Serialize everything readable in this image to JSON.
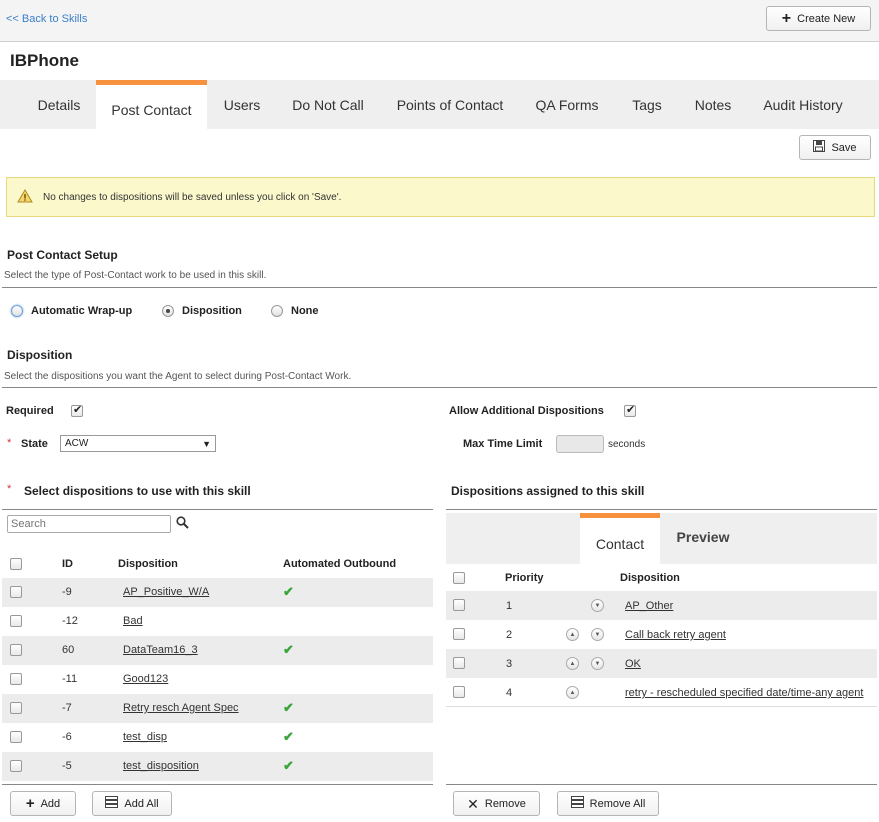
{
  "header": {
    "back_link": "<< Back to Skills",
    "create_new": "Create New"
  },
  "page_title": "IBPhone",
  "tabs": [
    "Details",
    "Post Contact",
    "Users",
    "Do Not Call",
    "Points of Contact",
    "QA Forms",
    "Tags",
    "Notes",
    "Audit History"
  ],
  "active_tab": "Post Contact",
  "toolbar": {
    "save": "Save"
  },
  "alert": {
    "text": "No changes to dispositions will be saved unless you click on 'Save'."
  },
  "setup": {
    "title": "Post Contact Setup",
    "desc": "Select the type of Post-Contact work to be used in this skill.",
    "options": [
      "Automatic Wrap-up",
      "Disposition",
      "None"
    ],
    "selected": "Disposition"
  },
  "disposition": {
    "title": "Disposition",
    "desc": "Select the dispositions you want the Agent to select during Post-Contact Work.",
    "required_label": "Required",
    "required_checked": true,
    "allow_label": "Allow Additional Dispositions",
    "allow_checked": true,
    "state_label": "State",
    "state_value": "ACW",
    "max_time_label": "Max Time Limit",
    "max_time_value": "",
    "seconds_label": "seconds"
  },
  "left_panel": {
    "title": "Select dispositions to use with this skill",
    "search_placeholder": "Search",
    "headers": {
      "id": "ID",
      "disposition": "Disposition",
      "automated": "Automated Outbound"
    },
    "rows": [
      {
        "id": "-9",
        "name": "AP_Positive_W/A",
        "auto": true
      },
      {
        "id": "-12",
        "name": "Bad",
        "auto": false
      },
      {
        "id": "60",
        "name": "DataTeam16_3",
        "auto": true
      },
      {
        "id": "-11",
        "name": "Good123",
        "auto": false
      },
      {
        "id": "-7",
        "name": "Retry resch Agent Spec",
        "auto": true
      },
      {
        "id": "-6",
        "name": "test_disp",
        "auto": true
      },
      {
        "id": "-5",
        "name": "test_disposition",
        "auto": true
      }
    ],
    "add": "Add",
    "add_all": "Add All"
  },
  "right_panel": {
    "title": "Dispositions assigned to this skill",
    "tabs": [
      "Contact",
      "Preview"
    ],
    "active_tab": "Contact",
    "headers": {
      "priority": "Priority",
      "disposition": "Disposition"
    },
    "rows": [
      {
        "priority": "1",
        "name": "AP_Other",
        "up": false,
        "down": true
      },
      {
        "priority": "2",
        "name": "Call back retry agent",
        "up": true,
        "down": true
      },
      {
        "priority": "3",
        "name": "OK",
        "up": true,
        "down": true
      },
      {
        "priority": "4",
        "name": "retry - rescheduled specified date/time-any agent",
        "up": true,
        "down": false
      }
    ],
    "remove": "Remove",
    "remove_all": "Remove All"
  },
  "colors": {
    "accent": "#f7913d",
    "link": "#3a7fc8",
    "alert_bg": "#fbf8cc",
    "row_alt": "#ececec",
    "check_green": "#3aa63a"
  }
}
